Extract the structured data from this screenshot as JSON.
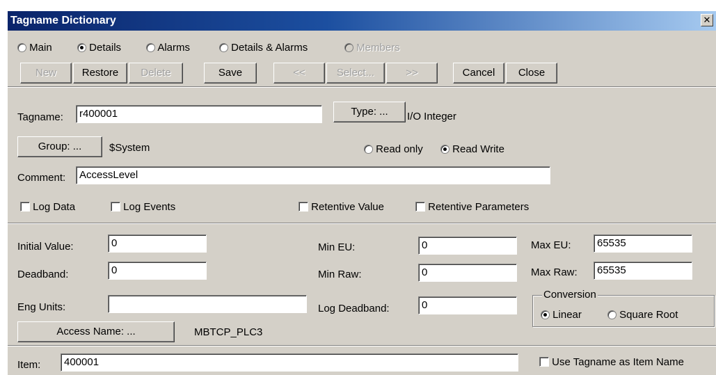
{
  "window": {
    "title": "Tagname Dictionary",
    "close_glyph": "✕"
  },
  "view_modes": [
    {
      "label": "Main",
      "selected": false,
      "enabled": true
    },
    {
      "label": "Details",
      "selected": true,
      "enabled": true
    },
    {
      "label": "Alarms",
      "selected": false,
      "enabled": true
    },
    {
      "label": "Details & Alarms",
      "selected": false,
      "enabled": true
    },
    {
      "label": "Members",
      "selected": false,
      "enabled": false
    }
  ],
  "toolbar": {
    "new": "New",
    "restore": "Restore",
    "delete": "Delete",
    "save": "Save",
    "prev": "<<",
    "select": "Select...",
    "next": ">>",
    "cancel": "Cancel",
    "close": "Close"
  },
  "tag": {
    "tagname_label": "Tagname:",
    "tagname_value": "r400001",
    "type_button": "Type: ...",
    "type_value": "I/O Integer",
    "group_button": "Group: ...",
    "group_value": "$System",
    "read_only_label": "Read only",
    "read_write_label": "Read Write",
    "access_mode": "Read Write",
    "comment_label": "Comment:",
    "comment_value": "AccessLevel",
    "log_data_label": "Log Data",
    "log_events_label": "Log Events",
    "retentive_value_label": "Retentive Value",
    "retentive_parameters_label": "Retentive Parameters"
  },
  "details": {
    "initial_value_label": "Initial Value:",
    "initial_value": "0",
    "deadband_label": "Deadband:",
    "deadband": "0",
    "eng_units_label": "Eng Units:",
    "eng_units": "",
    "min_eu_label": "Min EU:",
    "min_eu": "0",
    "min_raw_label": "Min Raw:",
    "min_raw": "0",
    "log_deadband_label": "Log Deadband:",
    "log_deadband": "0",
    "max_eu_label": "Max EU:",
    "max_eu": "65535",
    "max_raw_label": "Max Raw:",
    "max_raw": "65535",
    "conversion_label": "Conversion",
    "linear_label": "Linear",
    "square_root_label": "Square Root",
    "conversion": "Linear",
    "access_name_button": "Access Name: ...",
    "access_name_value": "MBTCP_PLC3",
    "item_label": "Item:",
    "item_value": "400001",
    "use_tagname_label": "Use Tagname as Item Name"
  }
}
